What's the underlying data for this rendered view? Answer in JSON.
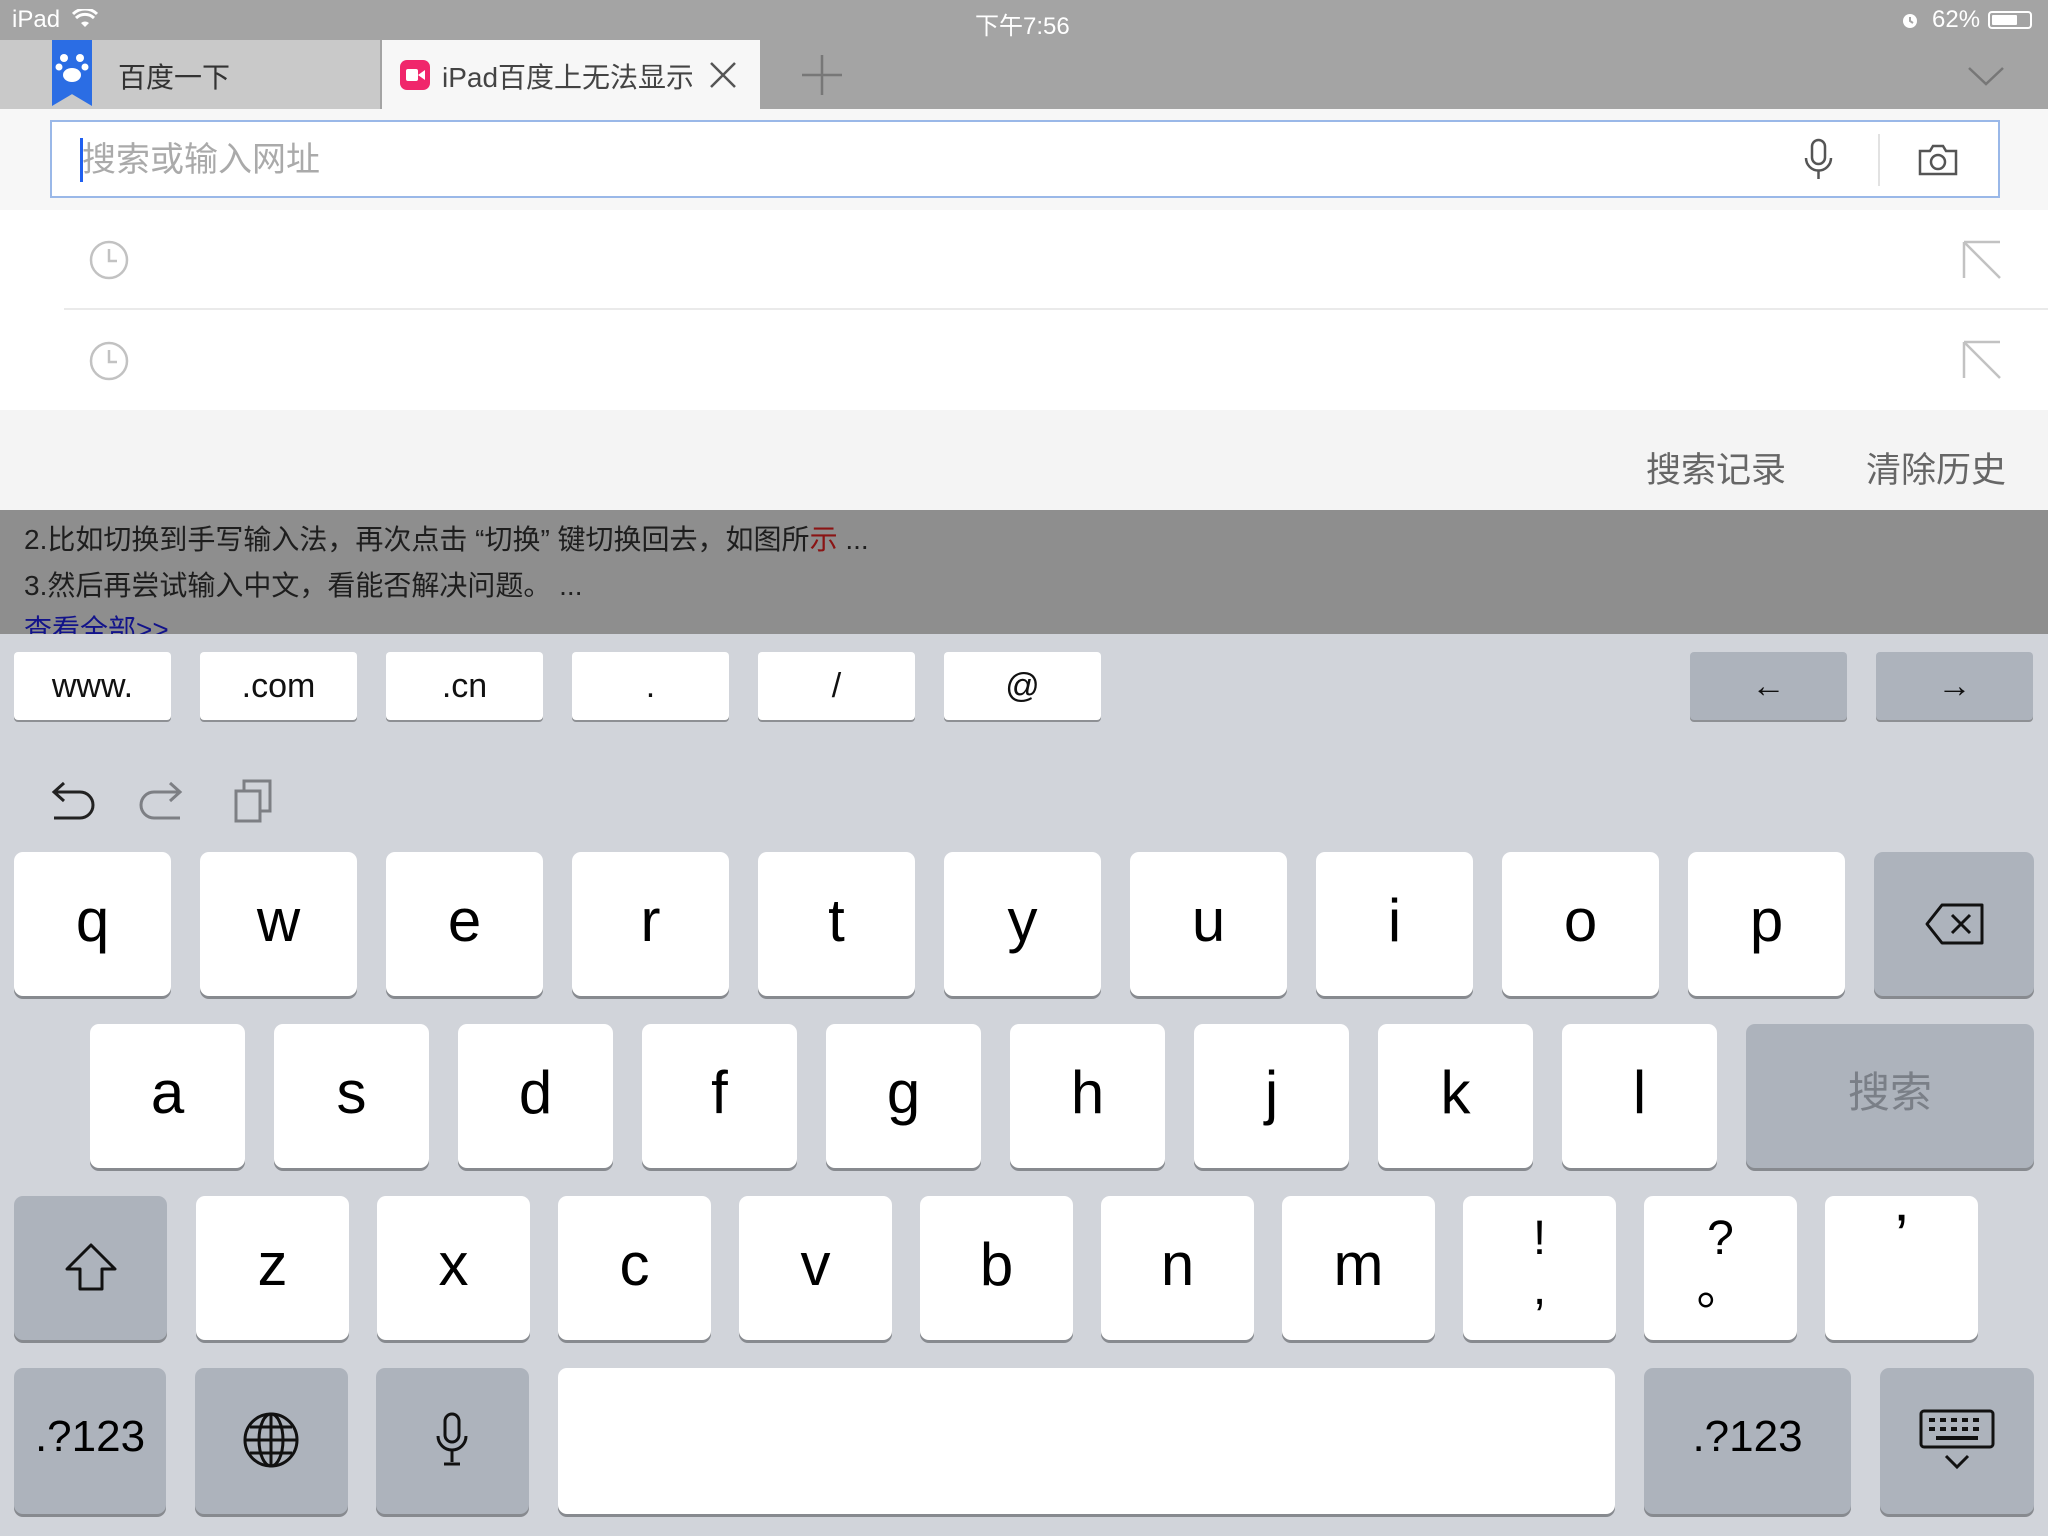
{
  "status": {
    "device": "iPad",
    "time": "下午7:56",
    "battery": "62%"
  },
  "tabs": [
    {
      "title": "百度一下",
      "icon": "baidu-paw-icon"
    },
    {
      "title": "iPad百度上无法显示",
      "icon": "video-app-icon"
    }
  ],
  "address": {
    "placeholder": "搜索或输入网址"
  },
  "actions": {
    "records": "搜索记录",
    "clear": "清除历史"
  },
  "page": {
    "line1_main": "2.比如切换到手写输入法，再次点击 “切换” 键切换回去，如图所",
    "line1_red": "示",
    "line1_tail": " ...",
    "line2": "3.然后再尝试输入中文，看能否解决问题。 ...",
    "more": "查看全部>>"
  },
  "shortcuts": [
    "www.",
    ".com",
    ".cn",
    ".",
    "/",
    "@"
  ],
  "arrows": {
    "left": "←",
    "right": "→"
  },
  "keys": {
    "row1": [
      "q",
      "w",
      "e",
      "r",
      "t",
      "y",
      "u",
      "i",
      "o",
      "p"
    ],
    "row2": [
      "a",
      "s",
      "d",
      "f",
      "g",
      "h",
      "j",
      "k",
      "l"
    ],
    "row3": [
      "z",
      "x",
      "c",
      "v",
      "b",
      "n",
      "m"
    ],
    "punct1_top": "!",
    "punct1_bottom": ",",
    "punct2_top": "?",
    "punct2_bottom": "。",
    "apostrophe": "’",
    "search": "搜索",
    "num_left": ".?123",
    "num_right": ".?123"
  }
}
